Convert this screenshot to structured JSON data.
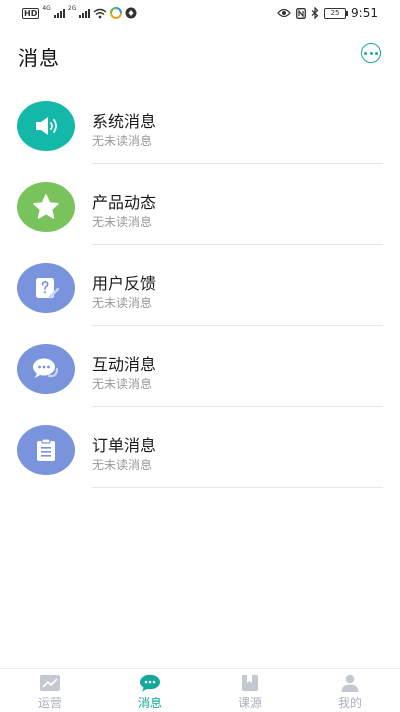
{
  "status_bar": {
    "network_hd": "HD",
    "network_4g": "4G",
    "network_2g": "2G",
    "battery": "25",
    "time": "9:51"
  },
  "header": {
    "title": "消息"
  },
  "messages": [
    {
      "title": "系统消息",
      "subtitle": "无未读消息",
      "icon": "speaker-icon",
      "color": "#14b8a8"
    },
    {
      "title": "产品动态",
      "subtitle": "无未读消息",
      "icon": "star-icon",
      "color": "#79c35d"
    },
    {
      "title": "用户反馈",
      "subtitle": "无未读消息",
      "icon": "feedback-icon",
      "color": "#7a93dd"
    },
    {
      "title": "互动消息",
      "subtitle": "无未读消息",
      "icon": "chat-bubble-icon",
      "color": "#7a93dd"
    },
    {
      "title": "订单消息",
      "subtitle": "无未读消息",
      "icon": "clipboard-icon",
      "color": "#7a93dd"
    }
  ],
  "tabs": [
    {
      "label": "运营",
      "icon": "chart-icon",
      "active": false
    },
    {
      "label": "消息",
      "icon": "message-icon",
      "active": true
    },
    {
      "label": "课源",
      "icon": "book-icon",
      "active": false
    },
    {
      "label": "我的",
      "icon": "person-icon",
      "active": false
    }
  ],
  "colors": {
    "accent": "#13a89a",
    "inactive_tab": "#aab0bb"
  }
}
